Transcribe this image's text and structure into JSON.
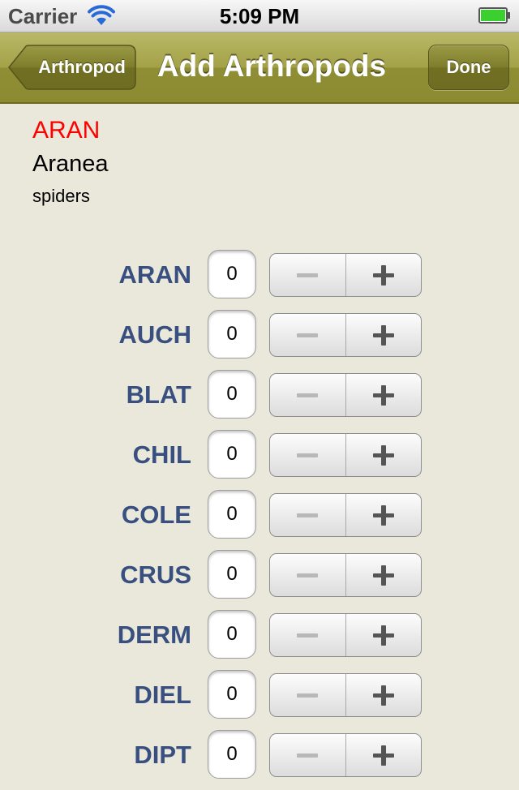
{
  "status_bar": {
    "carrier": "Carrier",
    "time": "5:09 PM",
    "wifi_icon": "wifi-icon",
    "battery_icon": "battery-icon",
    "battery_color": "#3ad02f"
  },
  "nav": {
    "back_label": "Arthropod",
    "title": "Add Arthropods",
    "done_label": "Done",
    "bar_color": "#a3a248"
  },
  "header": {
    "code": "ARAN",
    "name": "Aranea",
    "common_name": "spiders",
    "code_color": "#ff0000"
  },
  "label_color": "#384f80",
  "rows": [
    {
      "code": "ARAN",
      "count": "0"
    },
    {
      "code": "AUCH",
      "count": "0"
    },
    {
      "code": "BLAT",
      "count": "0"
    },
    {
      "code": "CHIL",
      "count": "0"
    },
    {
      "code": "COLE",
      "count": "0"
    },
    {
      "code": "CRUS",
      "count": "0"
    },
    {
      "code": "DERM",
      "count": "0"
    },
    {
      "code": "DIEL",
      "count": "0"
    },
    {
      "code": "DIPT",
      "count": "0"
    }
  ]
}
